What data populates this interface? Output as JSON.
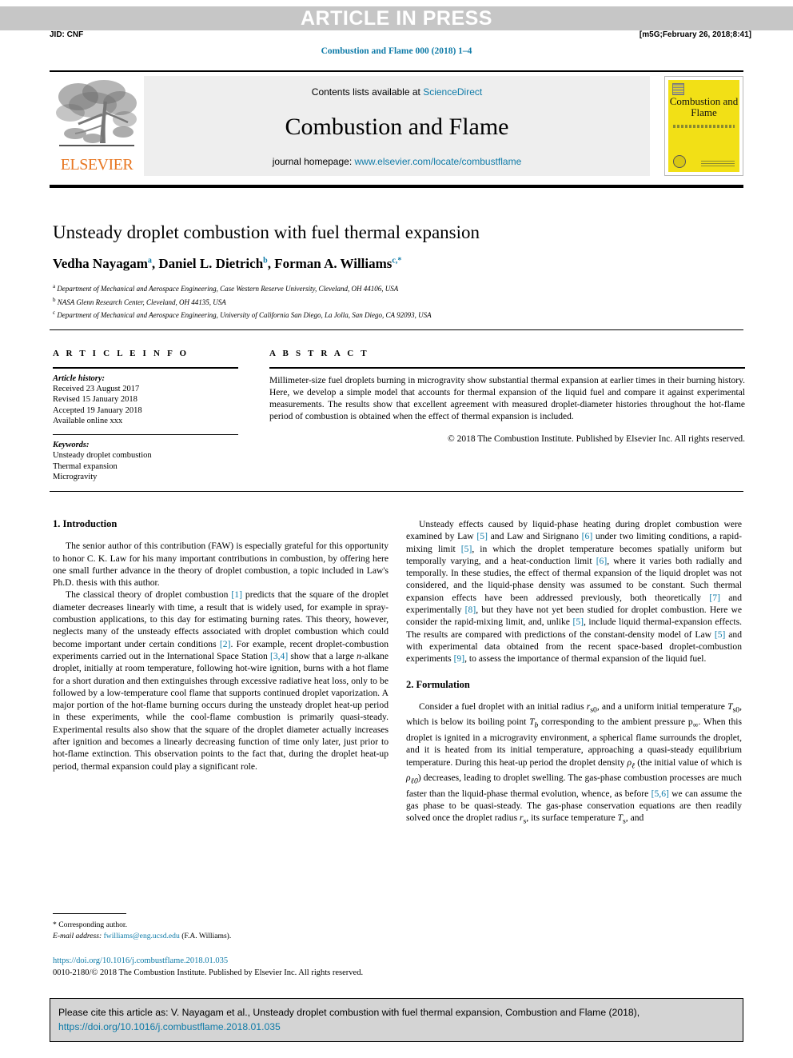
{
  "banner": {
    "text": "ARTICLE IN PRESS",
    "jid": "JID: CNF",
    "stamp": "[m5G;February 26, 2018;8:41]"
  },
  "journal_ref": "Combustion and Flame 000 (2018) 1–4",
  "masthead": {
    "contents_prefix": "Contents lists available at ",
    "contents_link": "ScienceDirect",
    "journal_name": "Combustion and Flame",
    "homepage_prefix": "journal homepage: ",
    "homepage_link": "www.elsevier.com/locate/combustflame",
    "publisher": "ELSEVIER",
    "cover_title": "Combustion and Flame"
  },
  "article": {
    "title": "Unsteady droplet combustion with fuel thermal expansion",
    "authors_html": "Vedha Nayagam<sup>a</sup>, Daniel L. Dietrich<sup>b</sup>, Forman A. Williams<sup>c,</sup><sup>*</sup>",
    "affiliations": [
      "Department of Mechanical and Aerospace Engineering, Case Western Reserve University, Cleveland, OH 44106, USA",
      "NASA Glenn Research Center, Cleveland, OH 44135, USA",
      "Department of Mechanical and Aerospace Engineering, University of California San Diego, La Jolla, San Diego, CA 92093, USA"
    ]
  },
  "info": {
    "heading": "A R T I C L E    I N F O",
    "history_label": "Article history:",
    "history": [
      "Received 23 August 2017",
      "Revised 15 January 2018",
      "Accepted 19 January 2018",
      "Available online xxx"
    ],
    "keywords_label": "Keywords:",
    "keywords": [
      "Unsteady droplet combustion",
      "Thermal expansion",
      "Microgravity"
    ]
  },
  "abstract": {
    "heading": "A B S T R A C T",
    "text": "Millimeter-size fuel droplets burning in microgravity show substantial thermal expansion at earlier times in their burning history. Here, we develop a simple model that accounts for thermal expansion of the liquid fuel and compare it against experimental measurements. The results show that excellent agreement with measured droplet-diameter histories throughout the hot-flame period of combustion is obtained when the effect of thermal expansion is included.",
    "copyright": "© 2018 The Combustion Institute. Published by Elsevier Inc. All rights reserved."
  },
  "body": {
    "intro_heading": "1. Introduction",
    "intro_p1": "The senior author of this contribution (FAW) is especially grateful for this opportunity to honor C. K. Law for his many important contributions in combustion, by offering here one small further advance in the theory of droplet combustion, a topic included in Law's Ph.D. thesis with this author.",
    "intro_p2_html": "The classical theory of droplet combustion <span class=\"ref\">[1]</span> predicts that the square of the droplet diameter decreases linearly with time, a result that is widely used, for example in spray-combustion applications, to this day for estimating burning rates. This theory, however, neglects many of the unsteady effects associated with droplet combustion which could become important under certain conditions <span class=\"ref\">[2]</span>. For example, recent droplet-combustion experiments carried out in the International Space Station <span class=\"ref\">[3,4]</span> show that a large <i>n</i>-alkane droplet, initially at room temperature, following hot-wire ignition, burns with a hot flame for a short duration and then extinguishes through excessive radiative heat loss, only to be followed by a low-temperature cool flame that supports continued droplet vaporization. A major portion of the hot-flame burning occurs during the unsteady droplet heat-up period in these experiments, while the cool-flame combustion is primarily quasi-steady. Experimental results also show that the square of the droplet diameter actually increases after ignition and becomes a linearly decreasing function of time only later, just prior to hot-flame extinction. This observation points to the fact that, during the droplet heat-up period, thermal expansion could play a significant role.",
    "right_p1_html": "Unsteady effects caused by liquid-phase heating during droplet combustion were examined by Law <span class=\"ref\">[5]</span> and Law and Sirignano <span class=\"ref\">[6]</span> under two limiting conditions, a rapid-mixing limit <span class=\"ref\">[5]</span>, in which the droplet temperature becomes spatially uniform but temporally varying, and a heat-conduction limit <span class=\"ref\">[6]</span>, where it varies both radially and temporally. In these studies, the effect of thermal expansion of the liquid droplet was not considered, and the liquid-phase density was assumed to be constant. Such thermal expansion effects have been addressed previously, both theoretically <span class=\"ref\">[7]</span> and experimentally <span class=\"ref\">[8]</span>, but they have not yet been studied for droplet combustion. Here we consider the rapid-mixing limit, and, unlike <span class=\"ref\">[5]</span>, include liquid thermal-expansion effects. The results are compared with predictions of the constant-density model of Law <span class=\"ref\">[5]</span> and with experimental data obtained from the recent space-based droplet-combustion experiments <span class=\"ref\">[9]</span>, to assess the importance of thermal expansion of the liquid fuel.",
    "formulation_heading": "2. Formulation",
    "formulation_p1_html": "Consider a fuel droplet with an initial radius <i>r</i><sub>s0</sub>, and a uniform initial temperature <i>T</i><sub>s0</sub>, which is below its boiling point <i>T<sub>b</sub></i> corresponding to the ambient pressure p<sub>∞</sub>. When this droplet is ignited in a microgravity environment, a spherical flame surrounds the droplet, and it is heated from its initial temperature, approaching a quasi-steady equilibrium temperature. During this heat-up period the droplet density <i>ρ<sub>ℓ</sub></i> (the initial value of which is <i>ρ<sub>ℓ0</sub></i>) decreases, leading to droplet swelling. The gas-phase combustion processes are much faster than the liquid-phase thermal evolution, whence, as before <span class=\"ref\">[5,6]</span> we can assume the gas phase to be quasi-steady. The gas-phase conservation equations are then readily solved once the droplet radius <i>r</i><sub>s</sub>, its surface temperature <i>T</i><sub>s</sub>, and"
  },
  "footer": {
    "corresponding": "* Corresponding author.",
    "email_label": "E-mail address:",
    "email": "fwilliams@eng.ucsd.edu",
    "email_owner": "(F.A. Williams).",
    "doi": "https://doi.org/10.1016/j.combustflame.2018.01.035",
    "issn": "0010-2180/© 2018 The Combustion Institute. Published by Elsevier Inc. All rights reserved."
  },
  "cite_box": {
    "text": "Please cite this article as: V. Nayagam et al., Unsteady droplet combustion with fuel thermal expansion, Combustion and Flame (2018),",
    "doi": "https://doi.org/10.1016/j.combustflame.2018.01.035"
  },
  "colors": {
    "link": "#0f7ba8",
    "banner_band": "#c6c6c6",
    "elsevier_orange": "#e87722",
    "cover_yellow": "#f2e016",
    "cite_bg": "#d4d4d4"
  }
}
